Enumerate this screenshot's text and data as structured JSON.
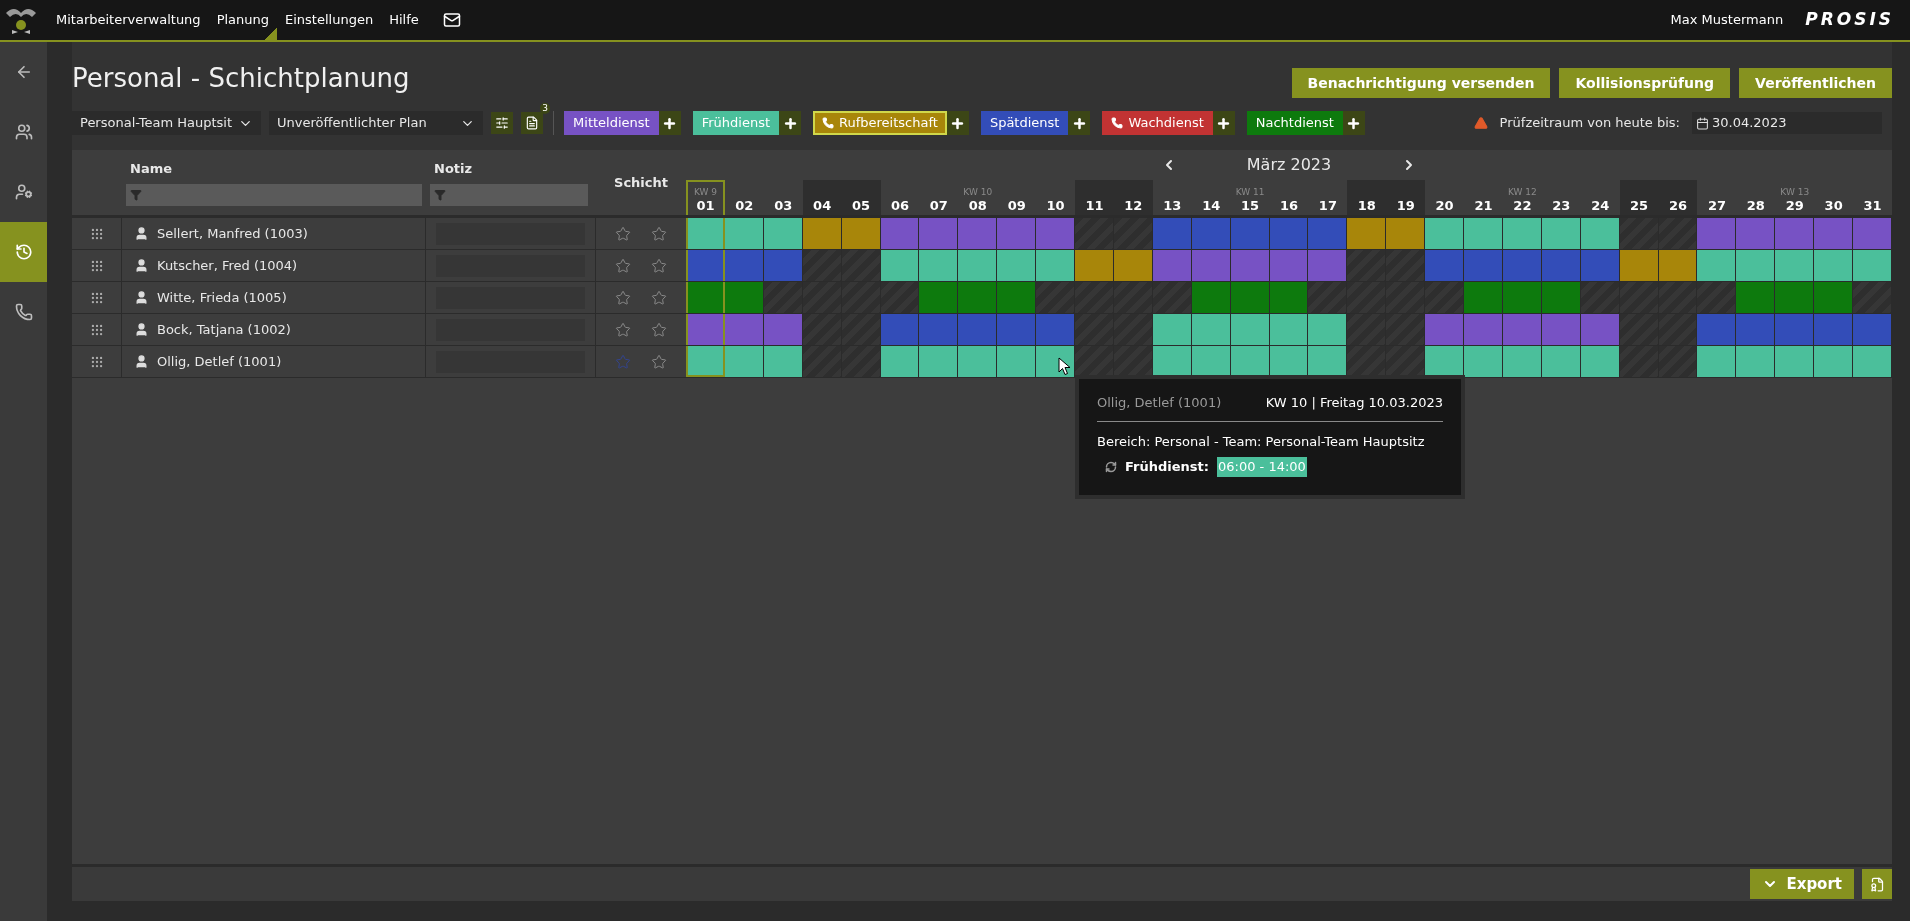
{
  "menu": [
    {
      "label": "Mitarbeiterverwaltung",
      "selected": false
    },
    {
      "label": "Planung",
      "selected": true
    },
    {
      "label": "Einstellungen",
      "selected": false
    },
    {
      "label": "Hilfe",
      "selected": false
    }
  ],
  "user": "Max Mustermann",
  "brand": "PROSIS",
  "sidebar": [
    {
      "kind": "back",
      "selected": false
    },
    {
      "kind": "team",
      "selected": false
    },
    {
      "kind": "user-settings",
      "selected": false
    },
    {
      "kind": "schedule",
      "selected": true
    },
    {
      "kind": "phone",
      "selected": false
    }
  ],
  "title": "Personal - Schichtplanung",
  "actions": [
    "Benachrichtigung versenden",
    "Kollisionsprüfung",
    "Veröffentlichen"
  ],
  "team_select": "Personal-Team Hauptsit",
  "plan_select": "Unveröffentlichter Plan",
  "notes_badge": "3",
  "shifts": [
    {
      "label": "Mitteldienst",
      "color": "#7752c4",
      "phone": false,
      "selected": false
    },
    {
      "label": "Frühdienst",
      "color": "#4bbf9b",
      "phone": false,
      "selected": false
    },
    {
      "label": "Rufbereitschaft",
      "color": "#a8860a",
      "phone": true,
      "selected": true
    },
    {
      "label": "Spätdienst",
      "color": "#334db8",
      "phone": false,
      "selected": false
    },
    {
      "label": "Wachdienst",
      "color": "#c23333",
      "phone": true,
      "selected": false
    },
    {
      "label": "Nachtdienst",
      "color": "#0d7a0d",
      "phone": false,
      "selected": false
    }
  ],
  "check_label": "Prüfzeitraum von heute bis:",
  "check_date": "30.04.2023",
  "columns": {
    "name": "Name",
    "note": "Notiz",
    "shift": "Schicht"
  },
  "month": "März 2023",
  "days": [
    {
      "label": "01",
      "week": "KW 9",
      "weekend": false,
      "selected": true
    },
    {
      "label": "02",
      "weekend": false,
      "selected": false
    },
    {
      "label": "03",
      "weekend": false,
      "selected": false
    },
    {
      "label": "04",
      "weekend": true,
      "selected": false
    },
    {
      "label": "05",
      "weekend": true,
      "selected": false
    },
    {
      "label": "06",
      "weekend": false,
      "selected": false
    },
    {
      "label": "07",
      "weekend": false,
      "selected": false
    },
    {
      "label": "08",
      "week": "KW 10",
      "weekend": false,
      "selected": false
    },
    {
      "label": "09",
      "weekend": false,
      "selected": false
    },
    {
      "label": "10",
      "weekend": false,
      "selected": false
    },
    {
      "label": "11",
      "weekend": true,
      "selected": false
    },
    {
      "label": "12",
      "weekend": true,
      "selected": false
    },
    {
      "label": "13",
      "weekend": false,
      "selected": false
    },
    {
      "label": "14",
      "weekend": false,
      "selected": false
    },
    {
      "label": "15",
      "week": "KW 11",
      "weekend": false,
      "selected": false
    },
    {
      "label": "16",
      "weekend": false,
      "selected": false
    },
    {
      "label": "17",
      "weekend": false,
      "selected": false
    },
    {
      "label": "18",
      "weekend": true,
      "selected": false
    },
    {
      "label": "19",
      "weekend": true,
      "selected": false
    },
    {
      "label": "20",
      "weekend": false,
      "selected": false
    },
    {
      "label": "21",
      "weekend": false,
      "selected": false
    },
    {
      "label": "22",
      "week": "KW 12",
      "weekend": false,
      "selected": false
    },
    {
      "label": "23",
      "weekend": false,
      "selected": false
    },
    {
      "label": "24",
      "weekend": false,
      "selected": false
    },
    {
      "label": "25",
      "weekend": true,
      "selected": false
    },
    {
      "label": "26",
      "weekend": true,
      "selected": false
    },
    {
      "label": "27",
      "weekend": false,
      "selected": false
    },
    {
      "label": "28",
      "weekend": false,
      "selected": false
    },
    {
      "label": "29",
      "week": "KW 13",
      "weekend": false,
      "selected": false
    },
    {
      "label": "30",
      "weekend": false,
      "selected": false
    },
    {
      "label": "31",
      "weekend": false,
      "selected": false
    }
  ],
  "rows": [
    {
      "name": "Sellert, Manfred (1003)",
      "stars": [
        {
          "active": false
        },
        {
          "active": false
        }
      ],
      "cells": [
        {
          "kind": "shift",
          "color": "#4bbf9b"
        },
        {
          "kind": "shift",
          "color": "#4bbf9b"
        },
        {
          "kind": "shift",
          "color": "#4bbf9b"
        },
        {
          "kind": "shift",
          "color": "#a8860a"
        },
        {
          "kind": "shift",
          "color": "#a8860a"
        },
        {
          "kind": "shift",
          "color": "#7752c4"
        },
        {
          "kind": "shift",
          "color": "#7752c4"
        },
        {
          "kind": "shift",
          "color": "#7752c4"
        },
        {
          "kind": "shift",
          "color": "#7752c4"
        },
        {
          "kind": "shift",
          "color": "#7752c4"
        },
        {
          "kind": "free"
        },
        {
          "kind": "free"
        },
        {
          "kind": "shift",
          "color": "#334db8"
        },
        {
          "kind": "shift",
          "color": "#334db8"
        },
        {
          "kind": "shift",
          "color": "#334db8"
        },
        {
          "kind": "shift",
          "color": "#334db8"
        },
        {
          "kind": "shift",
          "color": "#334db8"
        },
        {
          "kind": "shift",
          "color": "#a8860a"
        },
        {
          "kind": "shift",
          "color": "#a8860a"
        },
        {
          "kind": "shift",
          "color": "#4bbf9b"
        },
        {
          "kind": "shift",
          "color": "#4bbf9b"
        },
        {
          "kind": "shift",
          "color": "#4bbf9b"
        },
        {
          "kind": "shift",
          "color": "#4bbf9b"
        },
        {
          "kind": "shift",
          "color": "#4bbf9b"
        },
        {
          "kind": "free"
        },
        {
          "kind": "free"
        },
        {
          "kind": "shift",
          "color": "#7752c4"
        },
        {
          "kind": "shift",
          "color": "#7752c4"
        },
        {
          "kind": "shift",
          "color": "#7752c4"
        },
        {
          "kind": "shift",
          "color": "#7752c4"
        },
        {
          "kind": "shift",
          "color": "#7752c4"
        }
      ]
    },
    {
      "name": "Kutscher, Fred (1004)",
      "stars": [
        {
          "active": false
        },
        {
          "active": false
        }
      ],
      "cells": [
        {
          "kind": "shift",
          "color": "#334db8"
        },
        {
          "kind": "shift",
          "color": "#334db8"
        },
        {
          "kind": "shift",
          "color": "#334db8"
        },
        {
          "kind": "free"
        },
        {
          "kind": "free"
        },
        {
          "kind": "shift",
          "color": "#4bbf9b"
        },
        {
          "kind": "shift",
          "color": "#4bbf9b"
        },
        {
          "kind": "shift",
          "color": "#4bbf9b"
        },
        {
          "kind": "shift",
          "color": "#4bbf9b"
        },
        {
          "kind": "shift",
          "color": "#4bbf9b"
        },
        {
          "kind": "shift",
          "color": "#a8860a"
        },
        {
          "kind": "shift",
          "color": "#a8860a"
        },
        {
          "kind": "shift",
          "color": "#7752c4"
        },
        {
          "kind": "shift",
          "color": "#7752c4"
        },
        {
          "kind": "shift",
          "color": "#7752c4"
        },
        {
          "kind": "shift",
          "color": "#7752c4"
        },
        {
          "kind": "shift",
          "color": "#7752c4"
        },
        {
          "kind": "free"
        },
        {
          "kind": "free"
        },
        {
          "kind": "shift",
          "color": "#334db8"
        },
        {
          "kind": "shift",
          "color": "#334db8"
        },
        {
          "kind": "shift",
          "color": "#334db8"
        },
        {
          "kind": "shift",
          "color": "#334db8"
        },
        {
          "kind": "shift",
          "color": "#334db8"
        },
        {
          "kind": "shift",
          "color": "#a8860a"
        },
        {
          "kind": "shift",
          "color": "#a8860a"
        },
        {
          "kind": "shift",
          "color": "#4bbf9b"
        },
        {
          "kind": "shift",
          "color": "#4bbf9b"
        },
        {
          "kind": "shift",
          "color": "#4bbf9b"
        },
        {
          "kind": "shift",
          "color": "#4bbf9b"
        },
        {
          "kind": "shift",
          "color": "#4bbf9b"
        }
      ]
    },
    {
      "name": "Witte, Frieda (1005)",
      "stars": [
        {
          "active": false
        },
        {
          "active": false
        }
      ],
      "cells": [
        {
          "kind": "shift",
          "color": "#0d7a0d"
        },
        {
          "kind": "shift",
          "color": "#0d7a0d"
        },
        {
          "kind": "free"
        },
        {
          "kind": "free"
        },
        {
          "kind": "free"
        },
        {
          "kind": "free"
        },
        {
          "kind": "shift",
          "color": "#0d7a0d"
        },
        {
          "kind": "shift",
          "color": "#0d7a0d"
        },
        {
          "kind": "shift",
          "color": "#0d7a0d"
        },
        {
          "kind": "free"
        },
        {
          "kind": "free"
        },
        {
          "kind": "free"
        },
        {
          "kind": "free"
        },
        {
          "kind": "shift",
          "color": "#0d7a0d"
        },
        {
          "kind": "shift",
          "color": "#0d7a0d"
        },
        {
          "kind": "shift",
          "color": "#0d7a0d"
        },
        {
          "kind": "free"
        },
        {
          "kind": "free"
        },
        {
          "kind": "free"
        },
        {
          "kind": "free"
        },
        {
          "kind": "shift",
          "color": "#0d7a0d"
        },
        {
          "kind": "shift",
          "color": "#0d7a0d"
        },
        {
          "kind": "shift",
          "color": "#0d7a0d"
        },
        {
          "kind": "free"
        },
        {
          "kind": "free"
        },
        {
          "kind": "free"
        },
        {
          "kind": "free"
        },
        {
          "kind": "shift",
          "color": "#0d7a0d"
        },
        {
          "kind": "shift",
          "color": "#0d7a0d"
        },
        {
          "kind": "shift",
          "color": "#0d7a0d"
        },
        {
          "kind": "free"
        }
      ]
    },
    {
      "name": "Bock, Tatjana (1002)",
      "stars": [
        {
          "active": false
        },
        {
          "active": false
        }
      ],
      "cells": [
        {
          "kind": "shift",
          "color": "#7752c4"
        },
        {
          "kind": "shift",
          "color": "#7752c4"
        },
        {
          "kind": "shift",
          "color": "#7752c4"
        },
        {
          "kind": "free"
        },
        {
          "kind": "free"
        },
        {
          "kind": "shift",
          "color": "#334db8"
        },
        {
          "kind": "shift",
          "color": "#334db8"
        },
        {
          "kind": "shift",
          "color": "#334db8"
        },
        {
          "kind": "shift",
          "color": "#334db8"
        },
        {
          "kind": "shift",
          "color": "#334db8"
        },
        {
          "kind": "free"
        },
        {
          "kind": "free"
        },
        {
          "kind": "shift",
          "color": "#4bbf9b"
        },
        {
          "kind": "shift",
          "color": "#4bbf9b"
        },
        {
          "kind": "shift",
          "color": "#4bbf9b"
        },
        {
          "kind": "shift",
          "color": "#4bbf9b"
        },
        {
          "kind": "shift",
          "color": "#4bbf9b"
        },
        {
          "kind": "free"
        },
        {
          "kind": "free"
        },
        {
          "kind": "shift",
          "color": "#7752c4"
        },
        {
          "kind": "shift",
          "color": "#7752c4"
        },
        {
          "kind": "shift",
          "color": "#7752c4"
        },
        {
          "kind": "shift",
          "color": "#7752c4"
        },
        {
          "kind": "shift",
          "color": "#7752c4"
        },
        {
          "kind": "free"
        },
        {
          "kind": "free"
        },
        {
          "kind": "shift",
          "color": "#334db8"
        },
        {
          "kind": "shift",
          "color": "#334db8"
        },
        {
          "kind": "shift",
          "color": "#334db8"
        },
        {
          "kind": "shift",
          "color": "#334db8"
        },
        {
          "kind": "shift",
          "color": "#334db8"
        }
      ]
    },
    {
      "name": "Ollig, Detlef (1001)",
      "stars": [
        {
          "active": true
        },
        {
          "active": false
        }
      ],
      "cells": [
        {
          "kind": "shift",
          "color": "#4bbf9b"
        },
        {
          "kind": "shift",
          "color": "#4bbf9b"
        },
        {
          "kind": "shift",
          "color": "#4bbf9b"
        },
        {
          "kind": "free"
        },
        {
          "kind": "free"
        },
        {
          "kind": "shift",
          "color": "#4bbf9b"
        },
        {
          "kind": "shift",
          "color": "#4bbf9b"
        },
        {
          "kind": "shift",
          "color": "#4bbf9b"
        },
        {
          "kind": "shift",
          "color": "#4bbf9b"
        },
        {
          "kind": "shift",
          "color": "#4bbf9b"
        },
        {
          "kind": "free"
        },
        {
          "kind": "free"
        },
        {
          "kind": "shift",
          "color": "#4bbf9b"
        },
        {
          "kind": "shift",
          "color": "#4bbf9b"
        },
        {
          "kind": "shift",
          "color": "#4bbf9b"
        },
        {
          "kind": "shift",
          "color": "#4bbf9b"
        },
        {
          "kind": "shift",
          "color": "#4bbf9b"
        },
        {
          "kind": "free"
        },
        {
          "kind": "free"
        },
        {
          "kind": "shift",
          "color": "#4bbf9b"
        },
        {
          "kind": "shift",
          "color": "#4bbf9b"
        },
        {
          "kind": "shift",
          "color": "#4bbf9b"
        },
        {
          "kind": "shift",
          "color": "#4bbf9b"
        },
        {
          "kind": "shift",
          "color": "#4bbf9b"
        },
        {
          "kind": "free"
        },
        {
          "kind": "free"
        },
        {
          "kind": "shift",
          "color": "#4bbf9b"
        },
        {
          "kind": "shift",
          "color": "#4bbf9b"
        },
        {
          "kind": "shift",
          "color": "#4bbf9b"
        },
        {
          "kind": "shift",
          "color": "#4bbf9b"
        },
        {
          "kind": "shift",
          "color": "#4bbf9b"
        }
      ]
    }
  ],
  "tooltip": {
    "name": "Ollig, Detlef (1001)",
    "date": "KW 10 | Freitag 10.03.2023",
    "area": "Bereich: Personal - Team: Personal-Team Hauptsitz",
    "shift": "Frühdienst:",
    "time": "06:00 - 14:00",
    "color": "#4bbf9b"
  },
  "export": "Export"
}
